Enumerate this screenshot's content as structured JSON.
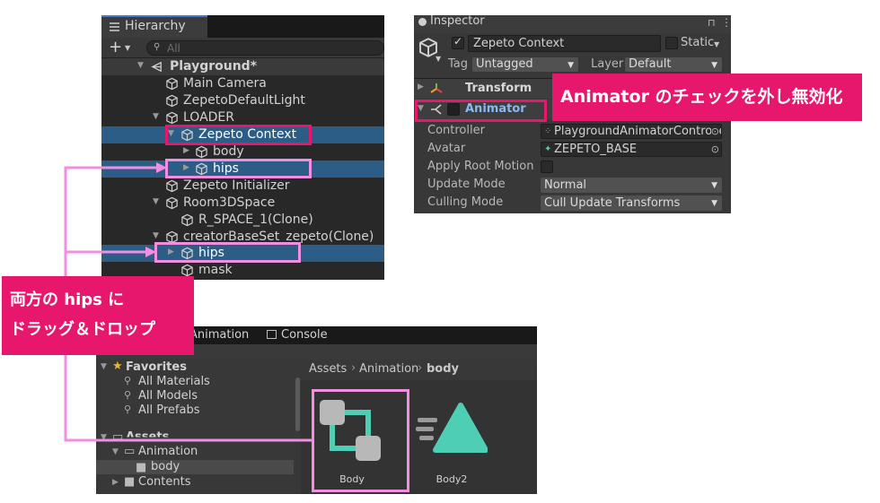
{
  "hierarchy": {
    "title": "Hierarchy",
    "search_placeholder": "All",
    "scene": "Playground*",
    "items": [
      {
        "label": "Main Camera"
      },
      {
        "label": "ZepetoDefaultLight"
      },
      {
        "label": "LOADER"
      },
      {
        "label": "Zepeto Context"
      },
      {
        "label": "body"
      },
      {
        "label": "hips"
      },
      {
        "label": "Zepeto Initializer"
      },
      {
        "label": "Room3DSpace"
      },
      {
        "label": "R_SPACE_1(Clone)"
      },
      {
        "label": "creatorBaseSet_zepeto(Clone)"
      },
      {
        "label": "hips"
      },
      {
        "label": "mask"
      }
    ]
  },
  "inspector": {
    "title": "Inspector",
    "object_name": "Zepeto Context",
    "static_label": "Static",
    "tag_label": "Tag",
    "tag_value": "Untagged",
    "layer_label": "Layer",
    "layer_value": "Default",
    "transform_label": "Transform",
    "animator_label": "Animator",
    "props": {
      "controller_label": "Controller",
      "controller_value": "PlaygroundAnimatorControlle",
      "avatar_label": "Avatar",
      "avatar_value": "ZEPETO_BASE",
      "apply_root_label": "Apply Root Motion",
      "update_mode_label": "Update Mode",
      "update_mode_value": "Normal",
      "culling_label": "Culling Mode",
      "culling_value": "Cull Update Transforms"
    }
  },
  "project": {
    "tab_animation": "Animation",
    "tab_console": "Console",
    "favorites_label": "Favorites",
    "favorites": [
      "All Materials",
      "All Models",
      "All Prefabs"
    ],
    "assets_label": "Assets",
    "tree_animation": "Animation",
    "tree_body": "body",
    "tree_contents": "Contents",
    "breadcrumb": [
      "Assets",
      "Animation",
      "body"
    ],
    "assets": [
      {
        "label": "Body",
        "icon": "animator-controller-icon"
      },
      {
        "label": "Body2",
        "icon": "animation-clip-icon"
      }
    ]
  },
  "annotations": {
    "animator_note": "Animator のチェックを外し無効化",
    "drag_note_line1": "両方の hips に",
    "drag_note_line2": "ドラッグ＆ドロップ"
  },
  "colors": {
    "highlight_magenta": "#e8176e",
    "highlight_pink": "#f08ee0",
    "selection_blue": "#2c5d87",
    "teal_icon": "#4ecfb5"
  }
}
